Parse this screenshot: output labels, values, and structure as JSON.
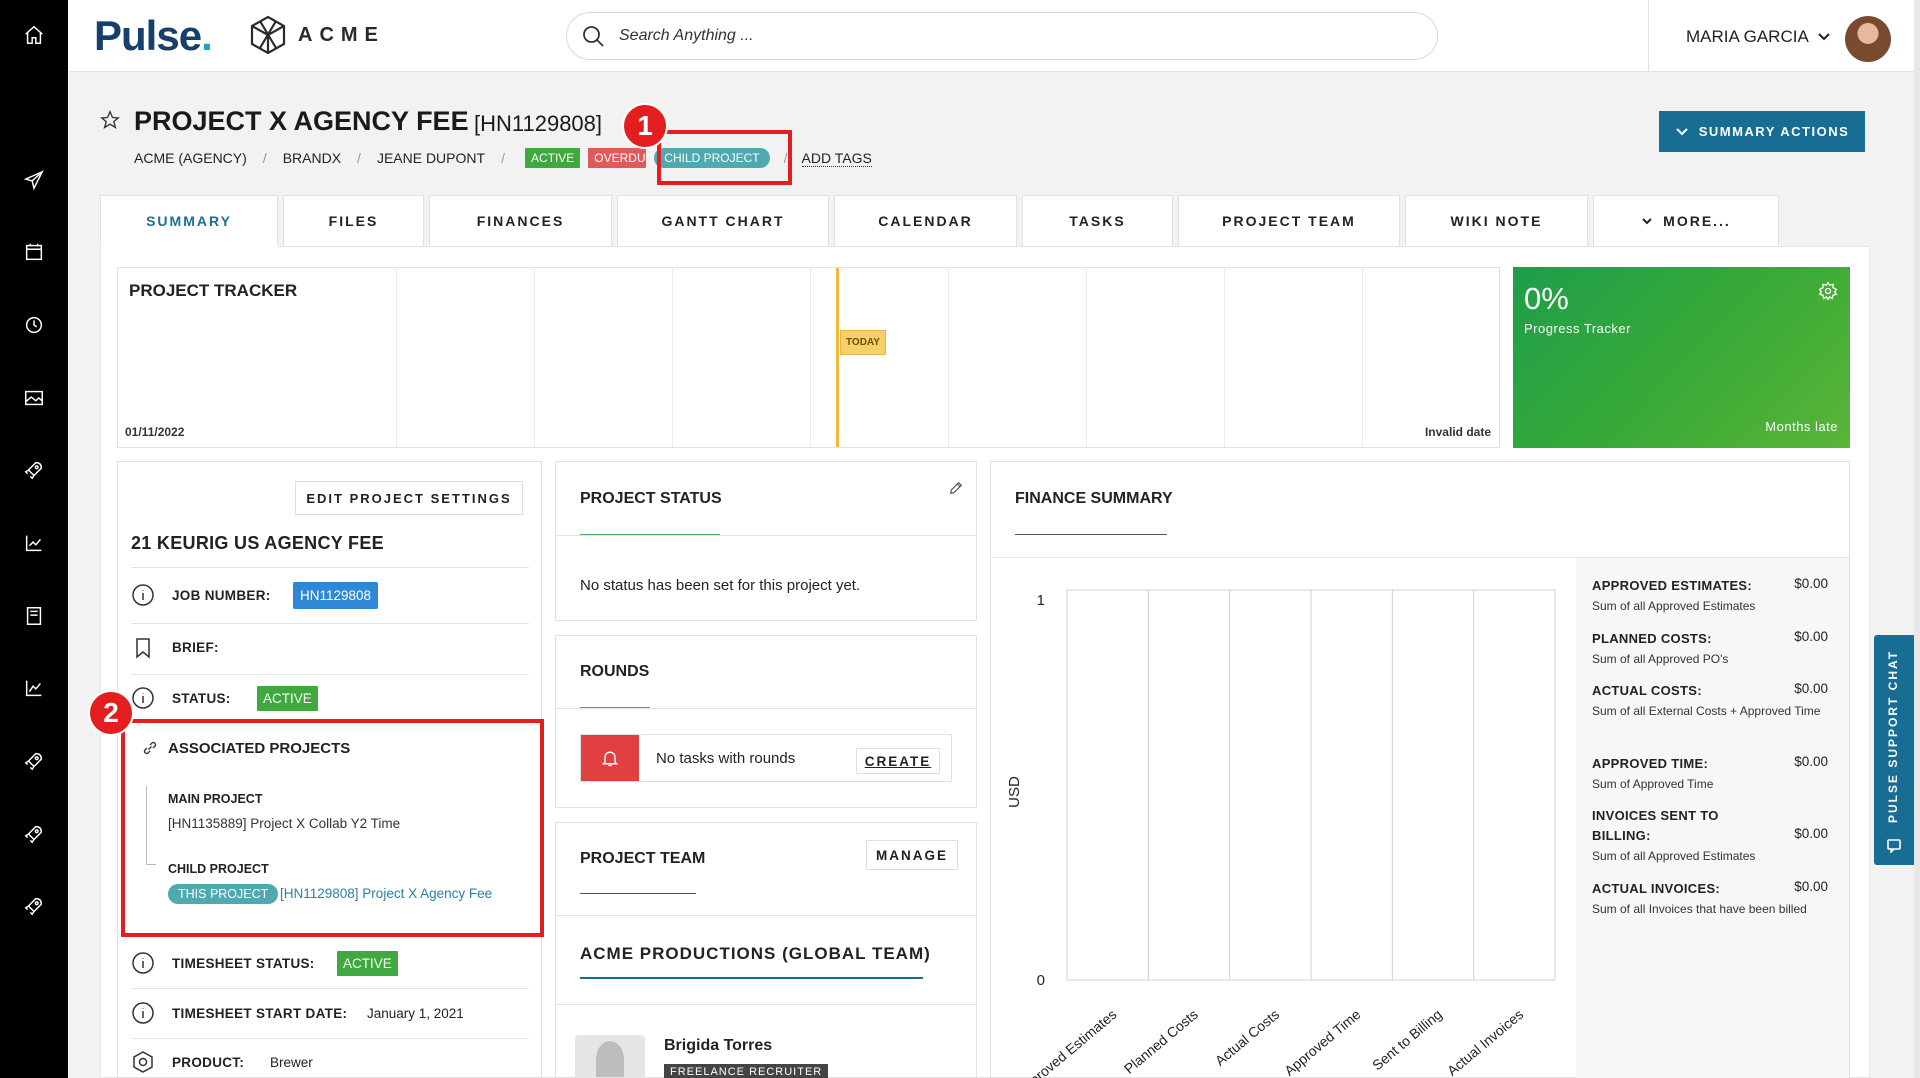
{
  "brand": {
    "pulse": "Pulse",
    "pulse_dot": ".",
    "acme": "ACME"
  },
  "search": {
    "placeholder": "Search Anything ..."
  },
  "user": {
    "name": "MARIA GARCIA"
  },
  "project": {
    "title": "PROJECT X AGENCY FEE",
    "code": "[HN1129808]",
    "crumbs": [
      "ACME (AGENCY)",
      "BRANDX",
      "JEANE DUPONT"
    ],
    "badges": {
      "active": "ACTIVE",
      "overdue": "OVERDUE",
      "child": "CHILD PROJECT"
    },
    "add_tags": "ADD TAGS"
  },
  "callouts": [
    "1",
    "2"
  ],
  "summary_actions": "SUMMARY ACTIONS",
  "tabs": [
    "SUMMARY",
    "FILES",
    "FINANCES",
    "GANTT CHART",
    "CALENDAR",
    "TASKS",
    "PROJECT TEAM",
    "WIKI NOTE",
    "MORE..."
  ],
  "tracker": {
    "title": "PROJECT TRACKER",
    "today": "TODAY",
    "start_date": "01/11/2022",
    "end_date": "Invalid date"
  },
  "progress": {
    "value": "0%",
    "label": "Progress Tracker",
    "late": "Months late"
  },
  "details": {
    "edit_button": "EDIT PROJECT SETTINGS",
    "name": "21 KEURIG US AGENCY FEE",
    "job_number_label": "JOB NUMBER:",
    "job_number": "HN1129808",
    "brief_label": "BRIEF:",
    "status_label": "STATUS:",
    "status": "ACTIVE",
    "associated_title": "ASSOCIATED PROJECTS",
    "main_project_label": "MAIN PROJECT",
    "main_project": "[HN1135889] Project X Collab Y2 Time",
    "child_project_label": "CHILD PROJECT",
    "this_project": "THIS PROJECT",
    "child_project": "[HN1129808] Project X Agency Fee",
    "timesheet_status_label": "TIMESHEET STATUS:",
    "timesheet_status": "ACTIVE",
    "timesheet_start_label": "TIMESHEET START DATE:",
    "timesheet_start": "January 1, 2021",
    "product_label": "PRODUCT:",
    "product": "Brewer"
  },
  "project_status": {
    "title": "PROJECT STATUS",
    "empty": "No status has been set for this project yet."
  },
  "rounds": {
    "title": "ROUNDS",
    "empty": "No tasks with rounds",
    "create": "CREATE"
  },
  "project_team": {
    "title": "PROJECT TEAM",
    "manage": "MANAGE",
    "team_name": "ACME PRODUCTIONS (GLOBAL TEAM)",
    "member_name": "Brigida Torres",
    "member_role": "FREELANCE RECRUITER"
  },
  "finance": {
    "title": "FINANCE SUMMARY",
    "items": [
      {
        "label": "APPROVED ESTIMATES:",
        "value": "$0.00",
        "desc": "Sum of all Approved Estimates"
      },
      {
        "label": "PLANNED COSTS:",
        "value": "$0.00",
        "desc": "Sum of all Approved PO's"
      },
      {
        "label": "ACTUAL COSTS:",
        "value": "$0.00",
        "desc": "Sum of all External Costs + Approved Time"
      },
      {
        "label": "APPROVED TIME:",
        "value": "$0.00",
        "desc": "Sum of Approved Time"
      },
      {
        "label": "INVOICES SENT TO BILLING:",
        "value": "$0.00",
        "desc": "Sum of all Approved Estimates"
      },
      {
        "label": "ACTUAL INVOICES:",
        "value": "$0.00",
        "desc": "Sum of all Invoices that have been billed"
      }
    ]
  },
  "chart_data": {
    "type": "bar",
    "categories": [
      "Approved Estimates",
      "Planned Costs",
      "Actual Costs",
      "Approved Time",
      "Sent to Billing",
      "Actual Invoices"
    ],
    "values": [
      0,
      0,
      0,
      0,
      0,
      0
    ],
    "title": "",
    "xlabel": "",
    "ylabel": "USD",
    "ylim": [
      0,
      1
    ],
    "yticks": [
      "1",
      "0"
    ],
    "grid": true
  },
  "support_chat": "PULSE SUPPORT CHAT",
  "colors": {
    "accent": "#176d93",
    "brand": "#16406b",
    "active": "#3fa83f",
    "overdue": "#e05a5a",
    "child": "#4fa9b1",
    "callout": "#e41e1e"
  }
}
